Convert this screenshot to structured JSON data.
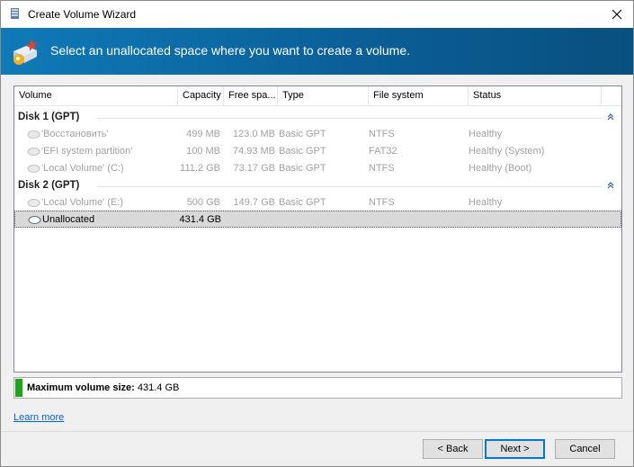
{
  "window": {
    "title": "Create Volume Wizard"
  },
  "banner": {
    "text": "Select an unallocated space where you want to create a volume."
  },
  "table": {
    "columns": [
      "Volume",
      "Capacity",
      "Free spa...",
      "Type",
      "File system",
      "Status"
    ],
    "groups": [
      {
        "label": "Disk 1 (GPT)",
        "rows": [
          {
            "volume": "'Восстановить'",
            "capacity": "499 MB",
            "free": "123.0 MB",
            "type": "Basic GPT",
            "fs": "NTFS",
            "status": "Healthy"
          },
          {
            "volume": "'EFI system partition'",
            "capacity": "100 MB",
            "free": "74.93 MB",
            "type": "Basic GPT",
            "fs": "FAT32",
            "status": "Healthy (System)"
          },
          {
            "volume": "'Local Volume' (C:)",
            "capacity": "111.2 GB",
            "free": "73.17 GB",
            "type": "Basic GPT",
            "fs": "NTFS",
            "status": "Healthy (Boot)"
          }
        ]
      },
      {
        "label": "Disk 2 (GPT)",
        "rows": [
          {
            "volume": "'Local Volume' (E:)",
            "capacity": "500 GB",
            "free": "149.7 GB",
            "type": "Basic GPT",
            "fs": "NTFS",
            "status": "Healthy"
          },
          {
            "volume": "Unallocated",
            "capacity": "431.4 GB",
            "free": "",
            "type": "",
            "fs": "",
            "status": "",
            "selected": true
          }
        ]
      }
    ]
  },
  "max_volume": {
    "label": "Maximum volume size:",
    "value": "431.4 GB"
  },
  "links": {
    "learn_more": "Learn more"
  },
  "buttons": {
    "back": "< Back",
    "next": "Next >",
    "cancel": "Cancel"
  },
  "icons": {
    "close": "close-icon",
    "collapse": "chevron-double-up-icon",
    "disk": "disk-icon",
    "wizard": "wizard-icon"
  },
  "colors": {
    "banner": "#0b5f98",
    "accent": "#0078d7",
    "size_bar": "#1aa71a",
    "link": "#0066cc"
  }
}
